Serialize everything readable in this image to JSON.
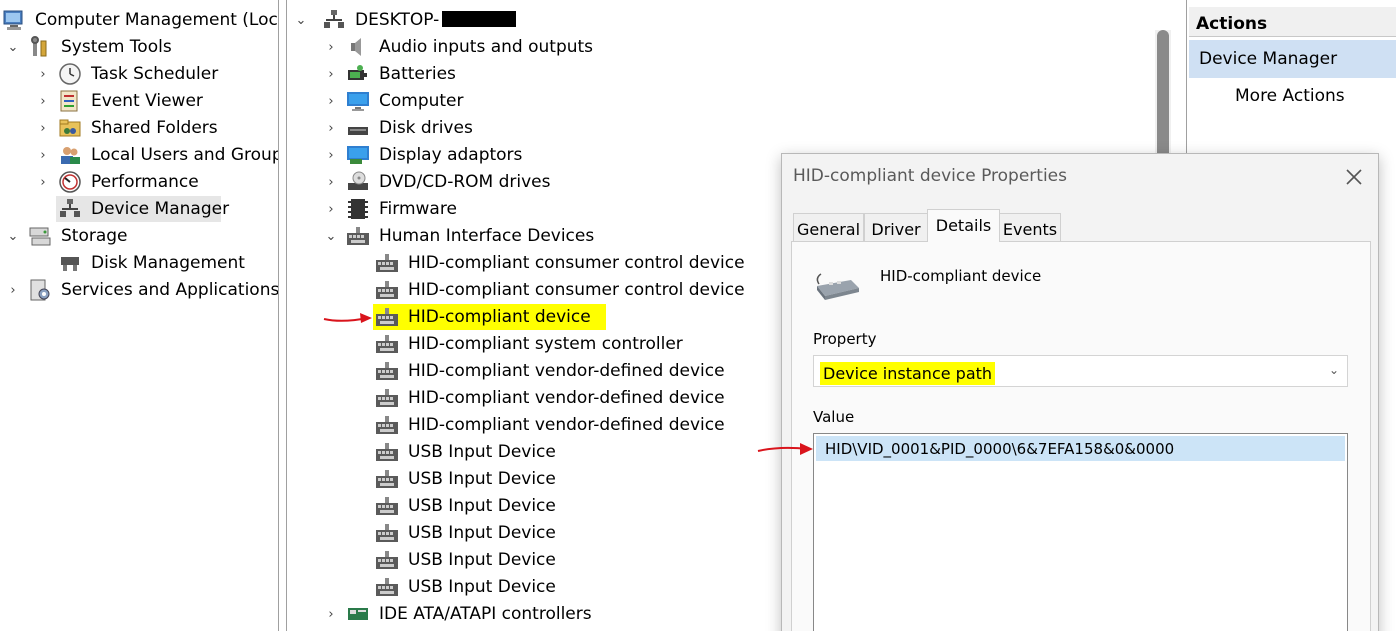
{
  "left_tree": {
    "root": "Computer Management (Local)",
    "system_tools": "System Tools",
    "task_scheduler": "Task Scheduler",
    "event_viewer": "Event Viewer",
    "shared_folders": "Shared Folders",
    "local_users": "Local Users and Groups",
    "performance": "Performance",
    "device_manager": "Device Manager",
    "storage": "Storage",
    "disk_management": "Disk Management",
    "services": "Services and Applications"
  },
  "device_tree": {
    "computer_name": "DESKTOP-",
    "categories": {
      "audio": "Audio inputs and outputs",
      "batteries": "Batteries",
      "computer": "Computer",
      "disk_drives": "Disk drives",
      "display": "Display adaptors",
      "dvd": "DVD/CD-ROM drives",
      "firmware": "Firmware",
      "hid": "Human Interface Devices",
      "ide": "IDE ATA/ATAPI controllers"
    },
    "hid_devices": [
      "HID-compliant consumer control device",
      "HID-compliant consumer control device",
      "HID-compliant device",
      "HID-compliant system controller",
      "HID-compliant vendor-defined device",
      "HID-compliant vendor-defined device",
      "HID-compliant vendor-defined device",
      "USB Input Device",
      "USB Input Device",
      "USB Input Device",
      "USB Input Device",
      "USB Input Device",
      "USB Input Device"
    ]
  },
  "actions": {
    "header": "Actions",
    "device_manager": "Device Manager",
    "more_actions": "More Actions"
  },
  "dialog": {
    "title": "HID-compliant device Properties",
    "tabs": [
      "General",
      "Driver",
      "Details",
      "Events"
    ],
    "active_tab": "Details",
    "device_name": "HID-compliant device",
    "property_label": "Property",
    "property_value": "Device instance path",
    "value_label": "Value",
    "value_text": "HID\\VID_0001&PID_0000\\6&7EFA158&0&0000"
  },
  "colors": {
    "highlight": "#ffff00",
    "selection_blue": "#cce4f7",
    "actions_selected": "#cfe0f3",
    "annotation_arrow": "#d9141c"
  }
}
